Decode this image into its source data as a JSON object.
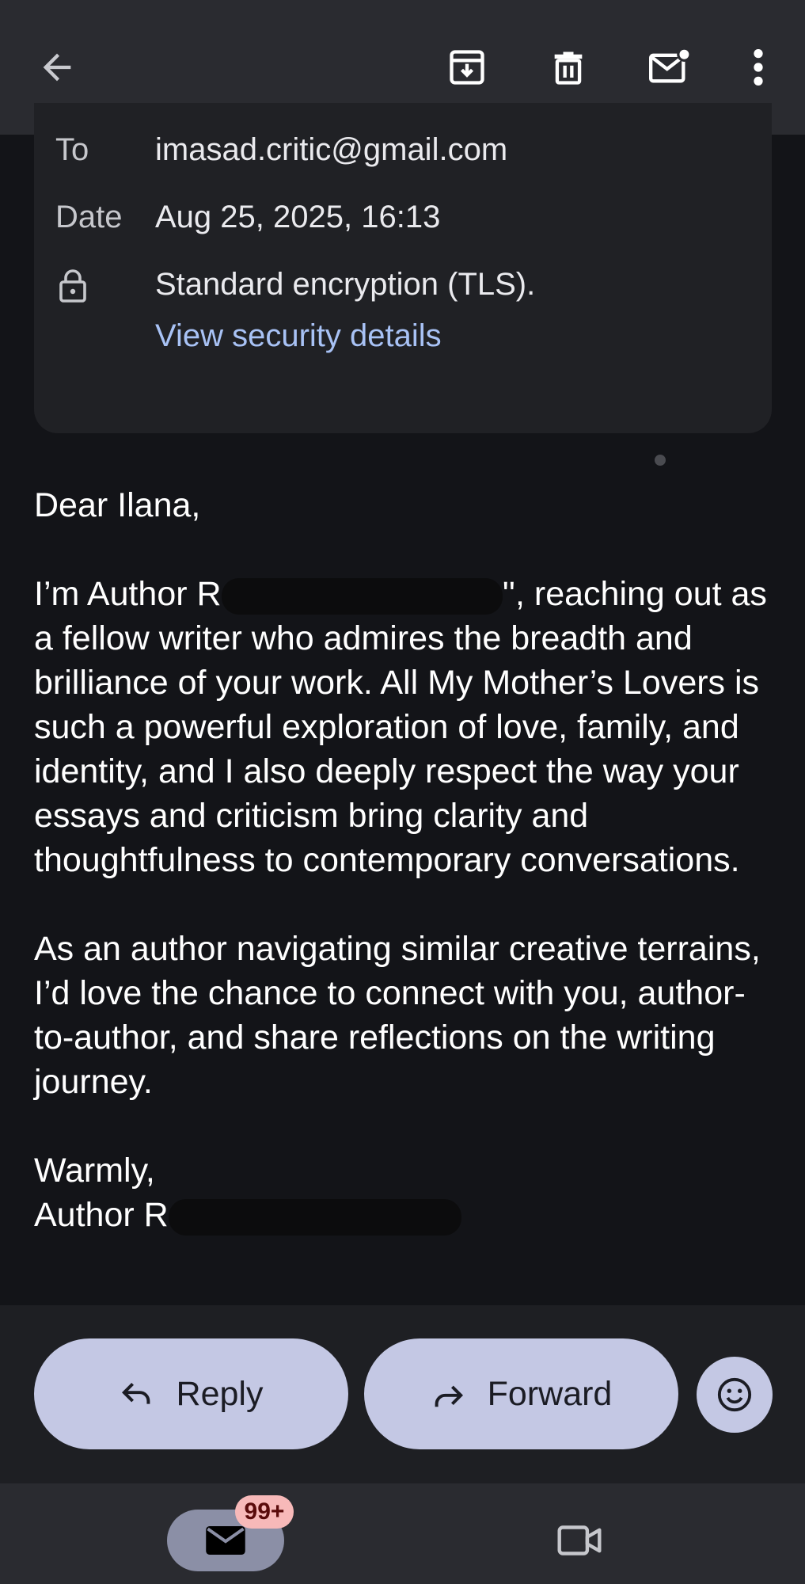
{
  "toolbar": {
    "back_icon": "arrow-back-icon",
    "archive_icon": "archive-icon",
    "delete_icon": "trash-icon",
    "mark_unread_icon": "mark-unread-icon",
    "more_icon": "more-vert-icon"
  },
  "details": {
    "to_label": "To",
    "to_value": "imasad.critic@gmail.com",
    "date_label": "Date",
    "date_value": "Aug 25, 2025, 16:13",
    "security_icon": "lock-icon",
    "security_text": "Standard encryption (TLS).",
    "security_link": "View security details"
  },
  "message": {
    "greeting": "Dear Ilana,",
    "p1_start": "I’m Author R",
    "p1_mid": "'', reaching out as",
    "p1_rest": "a fellow writer who admires the breadth and brilliance of your work. All My Mother’s Lovers is such a powerful exploration of love, family, and identity, and I also deeply respect the way your essays and criticism bring clarity and thoughtfulness to contemporary conversations.",
    "p2": "As an author navigating similar creative terrains, I’d love the chance to connect with you, author-to-author, and share reflections on the writing journey.",
    "signoff": "Warmly,",
    "signature": "Author R"
  },
  "actions": {
    "reply_label": "Reply",
    "forward_label": "Forward",
    "emoji_icon": "emoji-react-icon"
  },
  "nav": {
    "mail_icon": "mail-icon",
    "badge": "99+",
    "meet_icon": "video-camera-icon"
  },
  "colors": {
    "background": "#131418",
    "card": "#202125",
    "link": "#a8c2f5",
    "pill": "#c4c8e4",
    "badge": "#f7b9b9"
  }
}
